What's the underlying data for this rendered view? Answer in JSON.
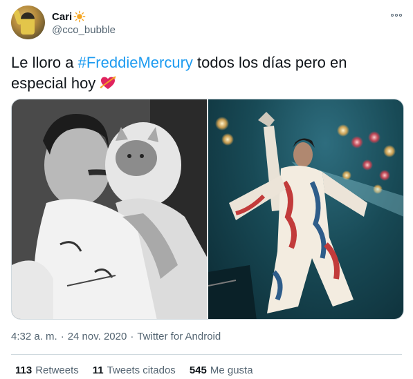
{
  "user": {
    "name": "Cari",
    "handle": "@cco_bubble"
  },
  "tweet": {
    "text_before": "Le lloro a ",
    "hashtag": "#FreddieMercury",
    "text_after": " todos los días pero en especial hoy"
  },
  "meta": {
    "time": "4:32 a. m.",
    "sep1": "·",
    "date": "24 nov. 2020",
    "sep2": "·",
    "source": "Twitter for Android"
  },
  "stats": {
    "retweets_count": "113",
    "retweets_label": "Retweets",
    "quotes_count": "11",
    "quotes_label": "Tweets citados",
    "likes_count": "545",
    "likes_label": "Me gusta"
  },
  "icons": {
    "sun": "sun-icon",
    "heart": "heart-with-arrow-icon",
    "more": "more-icon"
  },
  "colors": {
    "link": "#1d9bf0",
    "secondary_text": "#536471",
    "primary_text": "#0f1419"
  }
}
